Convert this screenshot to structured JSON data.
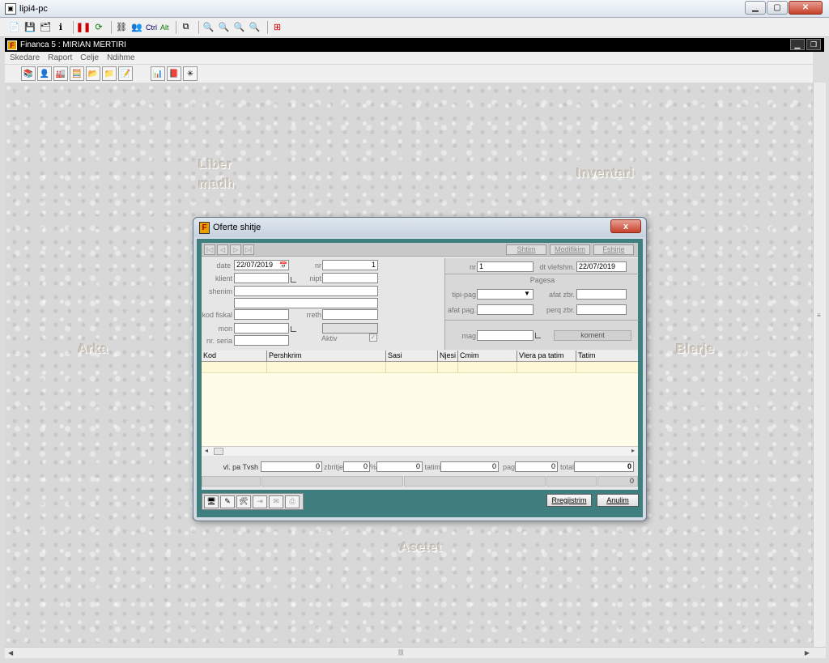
{
  "window": {
    "title": "lipi4-pc"
  },
  "toolbar1": {
    "ctrl_label": "Ctrl",
    "alt_label": "Alt"
  },
  "mdi": {
    "title": "Financa 5 :  MIRIAN MERTIRI"
  },
  "menu": {
    "items": [
      "Skedare",
      "Raport",
      "Celje",
      "Ndihme"
    ]
  },
  "desktop_labels": {
    "liber": "Liber",
    "madh": "madh",
    "inventar": "Inventari",
    "arka": "Arka",
    "blerje": "Blerje",
    "asetet": "Asetet"
  },
  "dialog": {
    "title": "Oferte shitje",
    "close_label": "x",
    "actions": {
      "shitim": "Shtim",
      "modifikim": "Modifikim",
      "fshirje": "Fshirje"
    },
    "left": {
      "date_label": "date",
      "date_value": "22/07/2019",
      "nr_label": "nr",
      "nr_value": "1",
      "klient_label": "klient",
      "klient_value": "",
      "nipt_label": "nipt",
      "nipt_value": "",
      "shenim_label": "shenim",
      "kod_fiskal_label": "kod fiskal",
      "rreth_label": "rreth",
      "mon_label": "mon",
      "nr_seria_label": "nr. seria",
      "aktiv_label": "Aktiv"
    },
    "right": {
      "nr_label": "nr",
      "nr_value": "1",
      "dt_vlefshm_label": "dt vlefshm.",
      "dt_vlefshm_value": "22/07/2019",
      "pagesa_label": "Pagesa",
      "tipi_pag_label": "tipi-pag",
      "afat_zbr_label": "afat zbr.",
      "afat_pag_label": "afat pag.",
      "perq_zbr_label": "perq zbr.",
      "mag_label": "mag",
      "koment_label": "koment"
    },
    "grid": {
      "columns": [
        "Kod",
        "Pershkrim",
        "Sasi",
        "Njesi",
        "Cmim",
        "Vlera pa tatim",
        "Tatim"
      ]
    },
    "totals": {
      "vl_pa_tvsh_label": "vl. pa Tvsh",
      "vl_pa_tvsh_value": "0",
      "zbritje_label": "zbritje",
      "zbritje_value": "0",
      "percent_label": "%",
      "percent_value": "0",
      "tatim_label": "tatim",
      "tatim_value": "0",
      "pag_label": "pag",
      "pag_value": "0",
      "total_label": "total",
      "total_value": "0"
    },
    "status_value": "0",
    "buttons": {
      "regjistrim": "Rregjistrim",
      "anulim": "Anulim"
    }
  }
}
